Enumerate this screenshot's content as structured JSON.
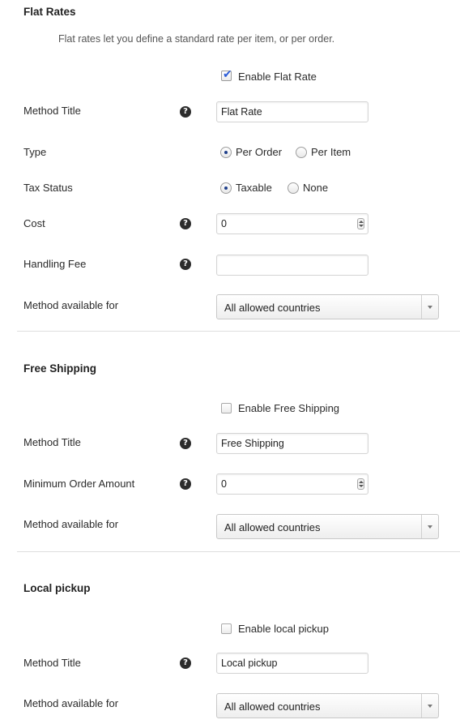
{
  "flat_rates": {
    "title": "Flat Rates",
    "description": "Flat rates let you define a standard rate per item, or per order.",
    "enable_label": "Enable Flat Rate",
    "enable_checked": true,
    "method_title_label": "Method Title",
    "method_title_value": "Flat Rate",
    "type_label": "Type",
    "type_options": [
      "Per Order",
      "Per Item"
    ],
    "type_selected": "Per Order",
    "tax_status_label": "Tax Status",
    "tax_options": [
      "Taxable",
      "None"
    ],
    "tax_selected": "Taxable",
    "cost_label": "Cost",
    "cost_value": "0",
    "handling_fee_label": "Handling Fee",
    "handling_fee_value": "",
    "availability_label": "Method available for",
    "availability_value": "All allowed countries"
  },
  "free_shipping": {
    "title": "Free Shipping",
    "enable_label": "Enable Free Shipping",
    "enable_checked": false,
    "method_title_label": "Method Title",
    "method_title_value": "Free Shipping",
    "min_amount_label": "Minimum Order Amount",
    "min_amount_value": "0",
    "availability_label": "Method available for",
    "availability_value": "All allowed countries"
  },
  "local_pickup": {
    "title": "Local pickup",
    "enable_label": "Enable local pickup",
    "enable_checked": false,
    "method_title_label": "Method Title",
    "method_title_value": "Local pickup",
    "availability_label": "Method available for",
    "availability_value": "All allowed countries"
  },
  "help_glyph": "?",
  "check_glyph": "✔",
  "icons": {
    "help": "question-circle-icon",
    "dropdown": "chevron-down-icon"
  }
}
